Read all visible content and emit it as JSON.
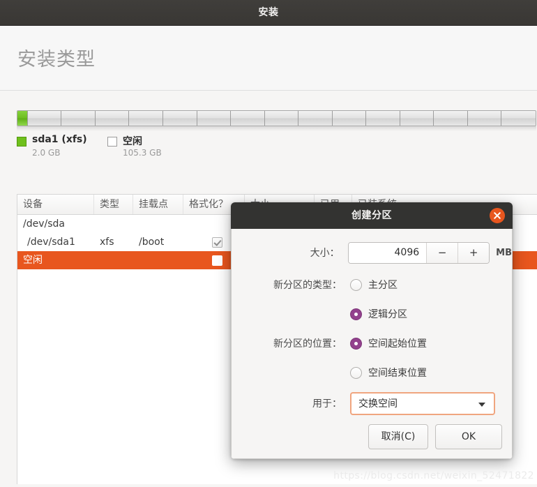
{
  "window": {
    "title": "安装"
  },
  "page": {
    "title": "安装类型"
  },
  "disk": {
    "legend": [
      {
        "name": "sda1 (xfs)",
        "size": "2.0 GB",
        "swatch": "green",
        "percent": 2
      },
      {
        "name": "空闲",
        "size": "105.3 GB",
        "swatch": "empty",
        "percent": 98
      }
    ]
  },
  "table": {
    "headers": [
      "设备",
      "类型",
      "挂载点",
      "格式化？",
      "大小",
      "已用",
      "已装系统"
    ],
    "rows": [
      {
        "device": "/dev/sda",
        "type": "",
        "mount": "",
        "format": null,
        "size": "",
        "used": "",
        "system": "",
        "selected": false,
        "indent": false
      },
      {
        "device": "/dev/sda1",
        "type": "xfs",
        "mount": "/boot",
        "format": true,
        "size": "",
        "used": "",
        "system": "",
        "selected": false,
        "indent": true
      },
      {
        "device": "空闲",
        "type": "",
        "mount": "",
        "format": false,
        "size": "",
        "used": "",
        "system": "",
        "selected": true,
        "indent": false
      }
    ]
  },
  "dialog": {
    "title": "创建分区",
    "close_icon": "close-icon",
    "size": {
      "label": "大小：",
      "value": "4096",
      "minus": "−",
      "plus": "+",
      "unit": "MB"
    },
    "partition_type": {
      "label": "新分区的类型：",
      "options": [
        {
          "label": "主分区",
          "selected": false
        },
        {
          "label": "逻辑分区",
          "selected": true
        }
      ]
    },
    "partition_location": {
      "label": "新分区的位置：",
      "options": [
        {
          "label": "空间起始位置",
          "selected": true
        },
        {
          "label": "空间结束位置",
          "selected": false
        }
      ]
    },
    "usage": {
      "label": "用于：",
      "value": "交换空间",
      "arrow_icon": "chevron-down-icon"
    },
    "buttons": {
      "cancel": "取消(C)",
      "ok": "OK"
    }
  },
  "watermark": {
    "text": "https://blog.csdn.net/weixin_52471822"
  },
  "colors": {
    "accent_orange": "#e8561e",
    "radio_purple": "#93418d",
    "disk_green": "#6fc01c",
    "titlebar_dark": "#393734"
  }
}
